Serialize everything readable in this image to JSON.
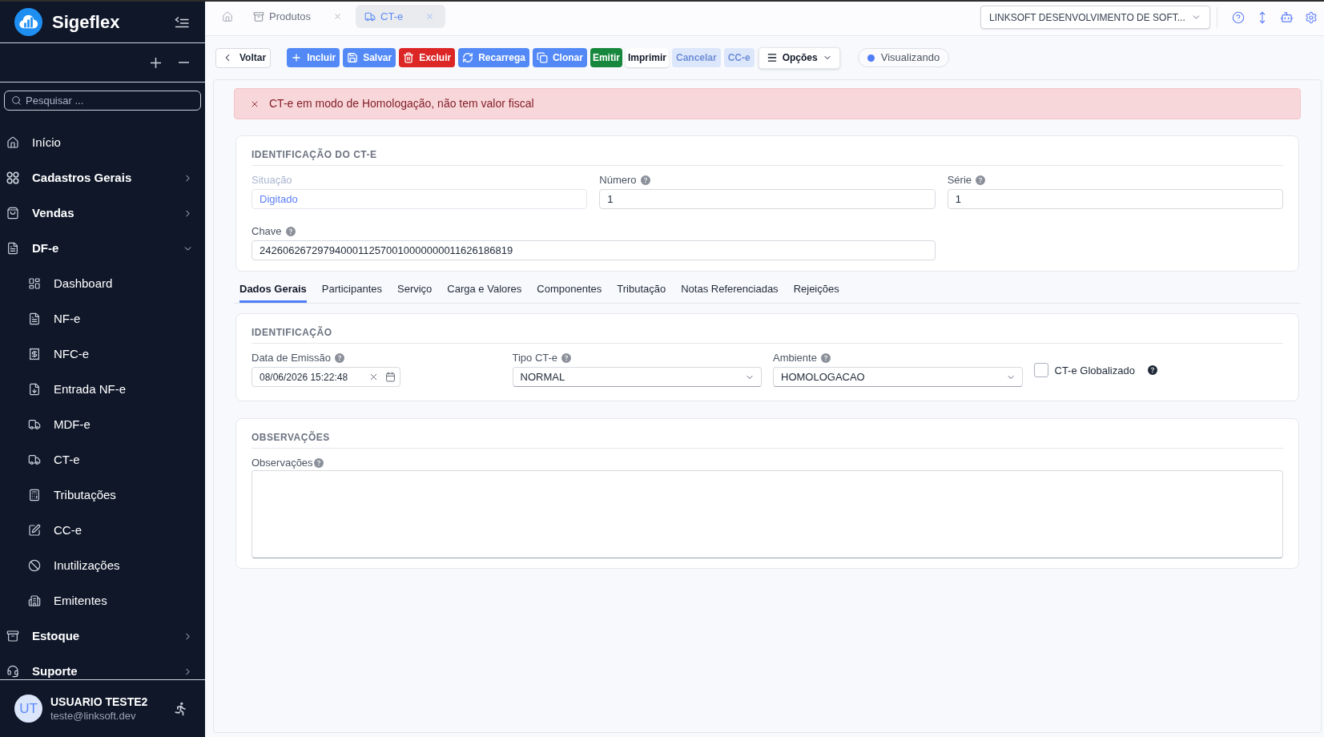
{
  "sidebar": {
    "brand": "Sigeflex",
    "search": {
      "placeholder": "Pesquisar ..."
    },
    "items": [
      {
        "label": "Início",
        "kind": "link"
      },
      {
        "label": "Cadastros Gerais",
        "kind": "group",
        "expanded": false
      },
      {
        "label": "Vendas",
        "kind": "group",
        "expanded": false
      },
      {
        "label": "DF-e",
        "kind": "group",
        "expanded": true,
        "children": [
          {
            "label": "Dashboard"
          },
          {
            "label": "NF-e"
          },
          {
            "label": "NFC-e"
          },
          {
            "label": "Entrada NF-e"
          },
          {
            "label": "MDF-e"
          },
          {
            "label": "CT-e"
          },
          {
            "label": "Tributações"
          },
          {
            "label": "CC-e"
          },
          {
            "label": "Inutilizações"
          },
          {
            "label": "Emitentes"
          }
        ]
      },
      {
        "label": "Estoque",
        "kind": "group",
        "expanded": false
      },
      {
        "label": "Suporte",
        "kind": "group",
        "expanded": false
      }
    ],
    "user": {
      "initials": "UT",
      "name": "USUARIO TESTE2",
      "email": "teste@linksoft.dev"
    }
  },
  "top_bar": {
    "tabs": [
      {
        "label": "Produtos",
        "selected": false
      },
      {
        "label": "CT-e",
        "selected": true
      }
    ],
    "company_select": {
      "value": "LINKSOFT DESENVOLVIMENTO DE SOFT..."
    }
  },
  "toolbar": {
    "buttons": [
      {
        "label": "Voltar",
        "kind": "outline",
        "disabled": false
      },
      {
        "label": "Incluir",
        "kind": "primary",
        "disabled": false
      },
      {
        "label": "Salvar",
        "kind": "primary",
        "disabled": false
      },
      {
        "label": "Excluir",
        "kind": "danger",
        "disabled": false
      },
      {
        "label": "Recarrega",
        "kind": "primary",
        "disabled": false
      },
      {
        "label": "Clonar",
        "kind": "primary",
        "disabled": false
      },
      {
        "label": "Emitir",
        "kind": "success",
        "disabled": false
      },
      {
        "label": "Imprimir",
        "kind": "plain",
        "disabled": false
      },
      {
        "label": "Cancelar",
        "kind": "primary",
        "disabled": true
      },
      {
        "label": "CC-e",
        "kind": "primary",
        "disabled": true
      },
      {
        "label": "Opções",
        "kind": "menu",
        "disabled": false
      }
    ],
    "mode": {
      "label": "Visualizando"
    }
  },
  "alert": {
    "message": "CT-e em modo de Homologação, não tem valor fiscal"
  },
  "identification": {
    "title": "IDENTIFICAÇÃO DO CT-E",
    "fields": [
      {
        "label": "Situação",
        "value": "Digitado",
        "help": false,
        "disabled": true
      },
      {
        "label": "Número",
        "value": "1",
        "help": true,
        "disabled": false
      },
      {
        "label": "Série",
        "value": "1",
        "help": true,
        "disabled": false
      },
      {
        "label": "Chave",
        "value": "24260626729794000112570010000000011626186819",
        "help": true,
        "disabled": false
      }
    ]
  },
  "tabs": [
    {
      "label": "Dados Gerais",
      "selected": true
    },
    {
      "label": "Participantes",
      "selected": false
    },
    {
      "label": "Serviço",
      "selected": false
    },
    {
      "label": "Carga e Valores",
      "selected": false
    },
    {
      "label": "Componentes",
      "selected": false
    },
    {
      "label": "Tributação",
      "selected": false
    },
    {
      "label": "Notas Referenciadas",
      "selected": false
    },
    {
      "label": "Rejeições",
      "selected": false
    }
  ],
  "sections": [
    {
      "title": "IDENTIFICAÇÃO",
      "fields": [
        {
          "kind": "datetime",
          "label": "Data de Emissão",
          "help": true,
          "value": "08/06/2026 15:22:48"
        },
        {
          "kind": "select",
          "label": "Tipo CT-e",
          "help": true,
          "value": "NORMAL"
        },
        {
          "kind": "select",
          "label": "Ambiente",
          "help": true,
          "value": "HOMOLOGACAO"
        },
        {
          "kind": "checkbox",
          "label": "CT-e Globalizado",
          "help": true,
          "checked": false
        }
      ]
    },
    {
      "title": "OBSERVAÇÕES",
      "fields": [
        {
          "kind": "textarea",
          "label": "Observações",
          "help": true
        }
      ]
    }
  ]
}
